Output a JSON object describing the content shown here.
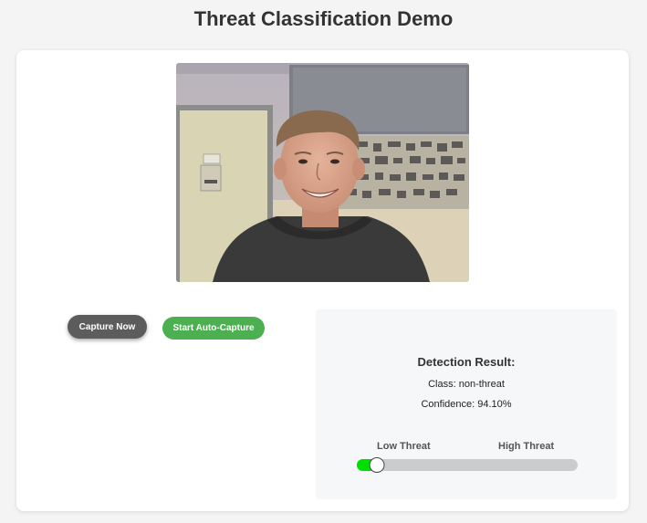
{
  "page": {
    "title": "Threat Classification Demo"
  },
  "controls": {
    "capture_label": "Capture Now",
    "auto_capture_label": "Start Auto-Capture"
  },
  "result": {
    "heading": "Detection Result:",
    "class_line": "Class: non-threat",
    "confidence_line": "Confidence: 94.10%",
    "scale_low_label": "Low Threat",
    "scale_high_label": "High Threat",
    "threat_level": 0.09
  },
  "colors": {
    "capture_button": "#5c5c5c",
    "auto_capture_button": "#4caf50",
    "meter_fill": "#00e000",
    "meter_track": "#cccccc"
  }
}
